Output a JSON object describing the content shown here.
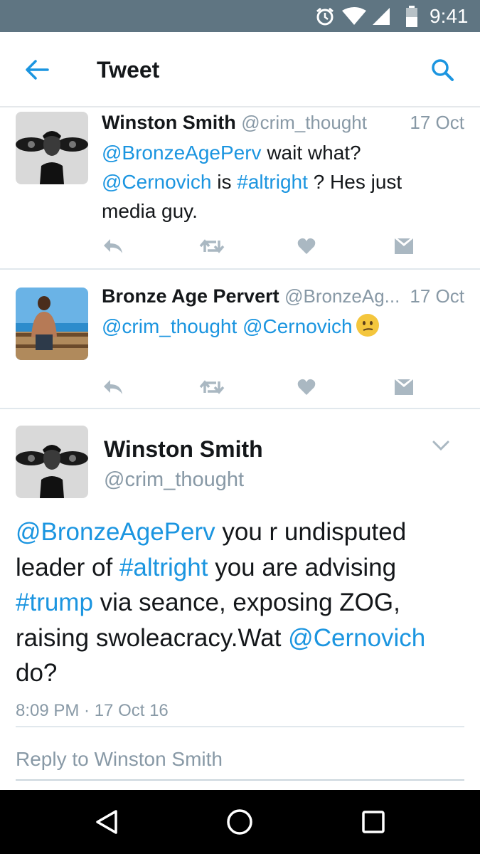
{
  "status_bar": {
    "time": "9:41",
    "icons": [
      "alarm-clock-icon",
      "wifi-icon",
      "cell-signal-icon",
      "battery-icon"
    ],
    "background": "#5f7582"
  },
  "header": {
    "title": "Tweet",
    "back_icon": "back-arrow-icon",
    "search_icon": "search-icon"
  },
  "colors": {
    "link": "#1b95e0",
    "muted": "#8899a6",
    "text": "#14171a"
  },
  "replies": [
    {
      "name": "Winston Smith",
      "handle": "@crim_thought",
      "date": "17 Oct",
      "body": {
        "mention1": "@BronzeAgePerv",
        "text1": " wait what?",
        "mention2": "@Cernovich",
        "text2": " is ",
        "hashtag": "#altright",
        "text3": " ?  Hes just media guy."
      }
    },
    {
      "name": "Bronze Age Pervert",
      "handle": "@BronzeAg...",
      "date": "17 Oct",
      "body": {
        "mention1": "@crim_thought",
        "mention2": "@Cernovich",
        "emoji": "confused-face-emoji"
      }
    }
  ],
  "main_tweet": {
    "name": "Winston Smith",
    "handle": "@crim_thought",
    "body": {
      "m1": "@BronzeAgePerv",
      "t1": " you r undisputed leader of ",
      "h1": "#altright",
      "t2": " you are advising ",
      "h2": "#trump",
      "t3": " via seance, exposing ZOG, raising swoleacracy.Wat ",
      "m2": "@Cernovich",
      "t4": " do?"
    },
    "timestamp": "8:09 PM · 17 Oct 16",
    "reply_placeholder": "Reply to Winston Smith"
  },
  "action_icons": [
    "reply-icon",
    "retweet-icon",
    "like-heart-icon",
    "direct-message-icon"
  ],
  "nav_bar": {
    "buttons": [
      "nav-back-icon",
      "nav-home-icon",
      "nav-recents-icon"
    ]
  }
}
